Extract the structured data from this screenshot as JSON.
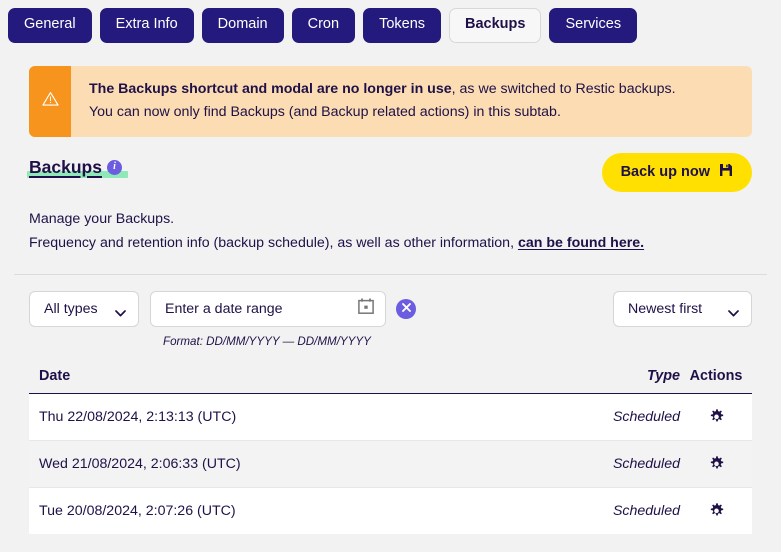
{
  "tabs": [
    {
      "label": "General",
      "active": false
    },
    {
      "label": "Extra Info",
      "active": false
    },
    {
      "label": "Domain",
      "active": false
    },
    {
      "label": "Cron",
      "active": false
    },
    {
      "label": "Tokens",
      "active": false
    },
    {
      "label": "Backups",
      "active": true
    },
    {
      "label": "Services",
      "active": false
    }
  ],
  "alert": {
    "icon": "warning-triangle-icon",
    "line1_bold": "The Backups shortcut and modal are no longer in use",
    "line1_rest": ", as we switched to Restic backups.",
    "line2": "You can now only find Backups (and Backup related actions) in this subtab.",
    "accent_color": "#f7941d",
    "background_color": "#fbdcb3"
  },
  "header": {
    "title": "Backups",
    "info_icon": "info-circle-icon",
    "highlight_color": "#8fe8b8",
    "backup_button": {
      "label": "Back up now",
      "icon": "save-disk-icon",
      "color": "#ffe000"
    }
  },
  "description": {
    "line1": "Manage your Backups.",
    "line2_prefix": "Frequency and retention info (backup schedule), as well as other information, ",
    "link_text": "can be found here."
  },
  "controls": {
    "type_filter": {
      "value": "All types",
      "icon": "chevron-down-icon"
    },
    "date_range": {
      "placeholder": "Enter a date range",
      "value": "",
      "icon": "calendar-icon",
      "format_hint": "Format: DD/MM/YYYY — DD/MM/YYYY"
    },
    "clear_button": {
      "icon": "close-circle-icon",
      "color": "#6c5ce0"
    },
    "sort": {
      "value": "Newest first",
      "icon": "chevron-down-icon"
    }
  },
  "table": {
    "columns": [
      "Date",
      "Type",
      "Actions"
    ],
    "rows": [
      {
        "date": "Thu 22/08/2024, 2:13:13 (UTC)",
        "type": "Scheduled",
        "action_icon": "gear-icon"
      },
      {
        "date": "Wed 21/08/2024, 2:06:33 (UTC)",
        "type": "Scheduled",
        "action_icon": "gear-icon"
      },
      {
        "date": "Tue 20/08/2024, 2:07:26 (UTC)",
        "type": "Scheduled",
        "action_icon": "gear-icon"
      }
    ]
  }
}
